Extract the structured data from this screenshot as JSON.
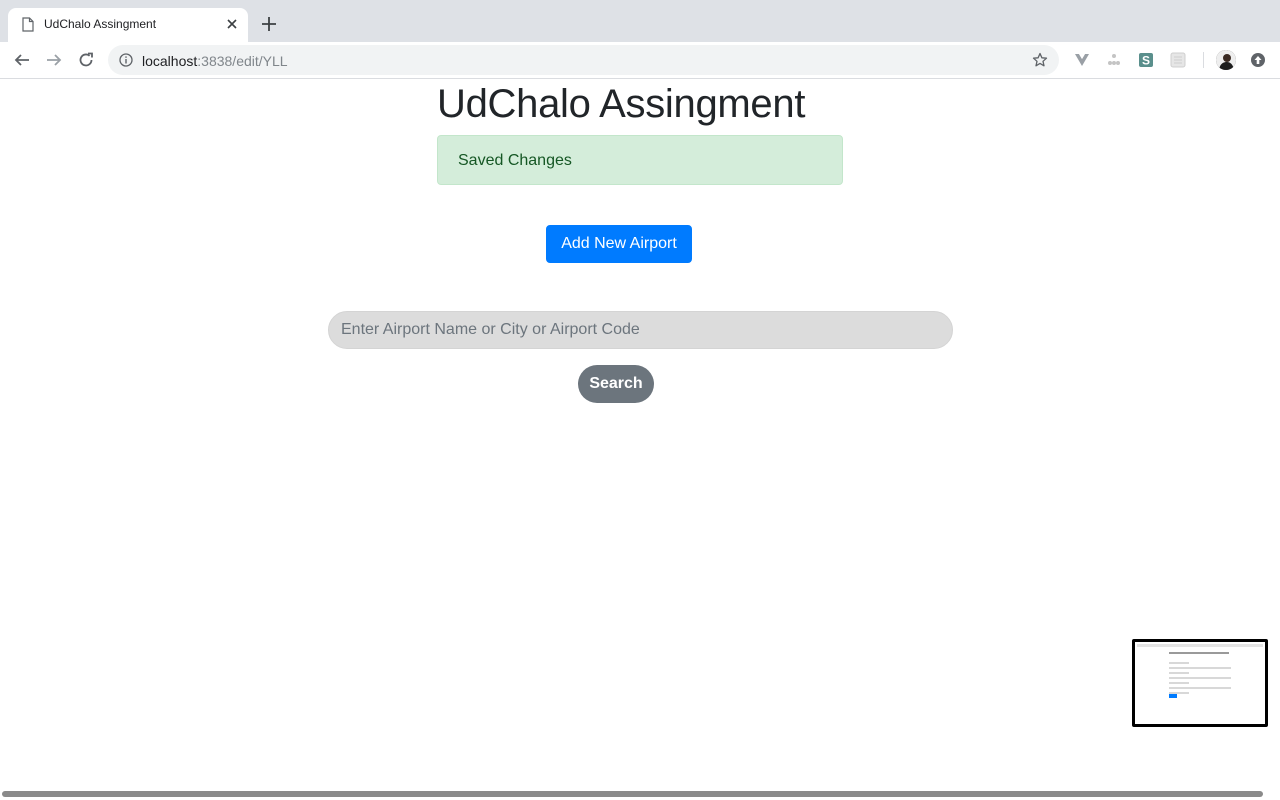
{
  "browser": {
    "tab_title": "UdChalo Assingment",
    "url_host": "localhost",
    "url_path": ":3838/edit/YLL",
    "icons": [
      "doc-icon",
      "close-icon",
      "plus-icon",
      "back-arrow-icon",
      "forward-arrow-icon",
      "reload-icon",
      "info-icon",
      "star-icon",
      "vue-devtools-icon",
      "extension-icon",
      "s-extension-icon",
      "grid-extension-icon",
      "avatar",
      "update-icon"
    ]
  },
  "page": {
    "heading": "UdChalo Assingment",
    "alert_text": "Saved Changes",
    "add_button_label": "Add New Airport",
    "search_placeholder": "Enter Airport Name or City or Airport Code",
    "search_button_label": "Search"
  },
  "colors": {
    "primary": "#007bff",
    "secondary": "#6c757d",
    "success_bg": "#d4edda",
    "success_text": "#155724"
  }
}
